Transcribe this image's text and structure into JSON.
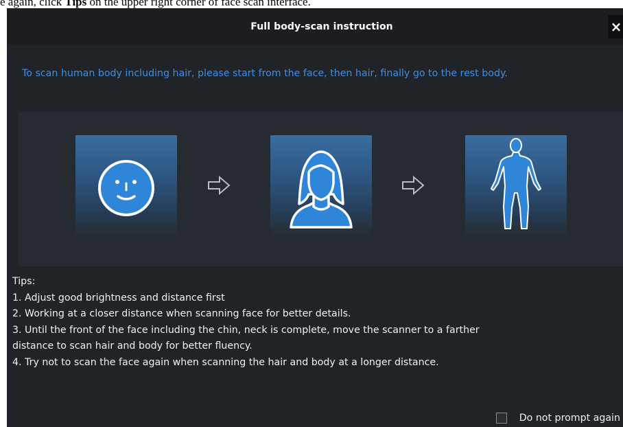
{
  "context_text": {
    "prefix": "e again, click ",
    "bold": "Tips",
    "suffix": " on the upper right corner of face scan interface."
  },
  "dialog": {
    "title": "Full body-scan instruction",
    "close_label": "×",
    "intro": "To scan human body including hair, please start from the face, then hair, finally go to the rest body.",
    "steps": [
      {
        "icon": "face-icon"
      },
      {
        "icon": "hair-person-icon"
      },
      {
        "icon": "full-body-icon"
      }
    ],
    "tips": {
      "heading": "Tips:",
      "lines": [
        "1. Adjust good brightness and distance first",
        "2. Working at a closer distance when scanning face for better details.",
        "3. Until the front of the face including the chin, neck is complete,  move the scanner to a farther",
        "distance to scan hair and body  for better fluency.",
        "4. Try not to scan the face again when scanning the hair and body at a longer distance."
      ]
    },
    "do_not_prompt": {
      "label": "Do not prompt again",
      "checked": false
    }
  },
  "colors": {
    "dialog_bg": "#202327",
    "titlebar_bg": "#1b1d21",
    "accent_blue": "#3a8fe8",
    "card_top": "#3a6da0",
    "icon_blue": "#2f86d8"
  }
}
